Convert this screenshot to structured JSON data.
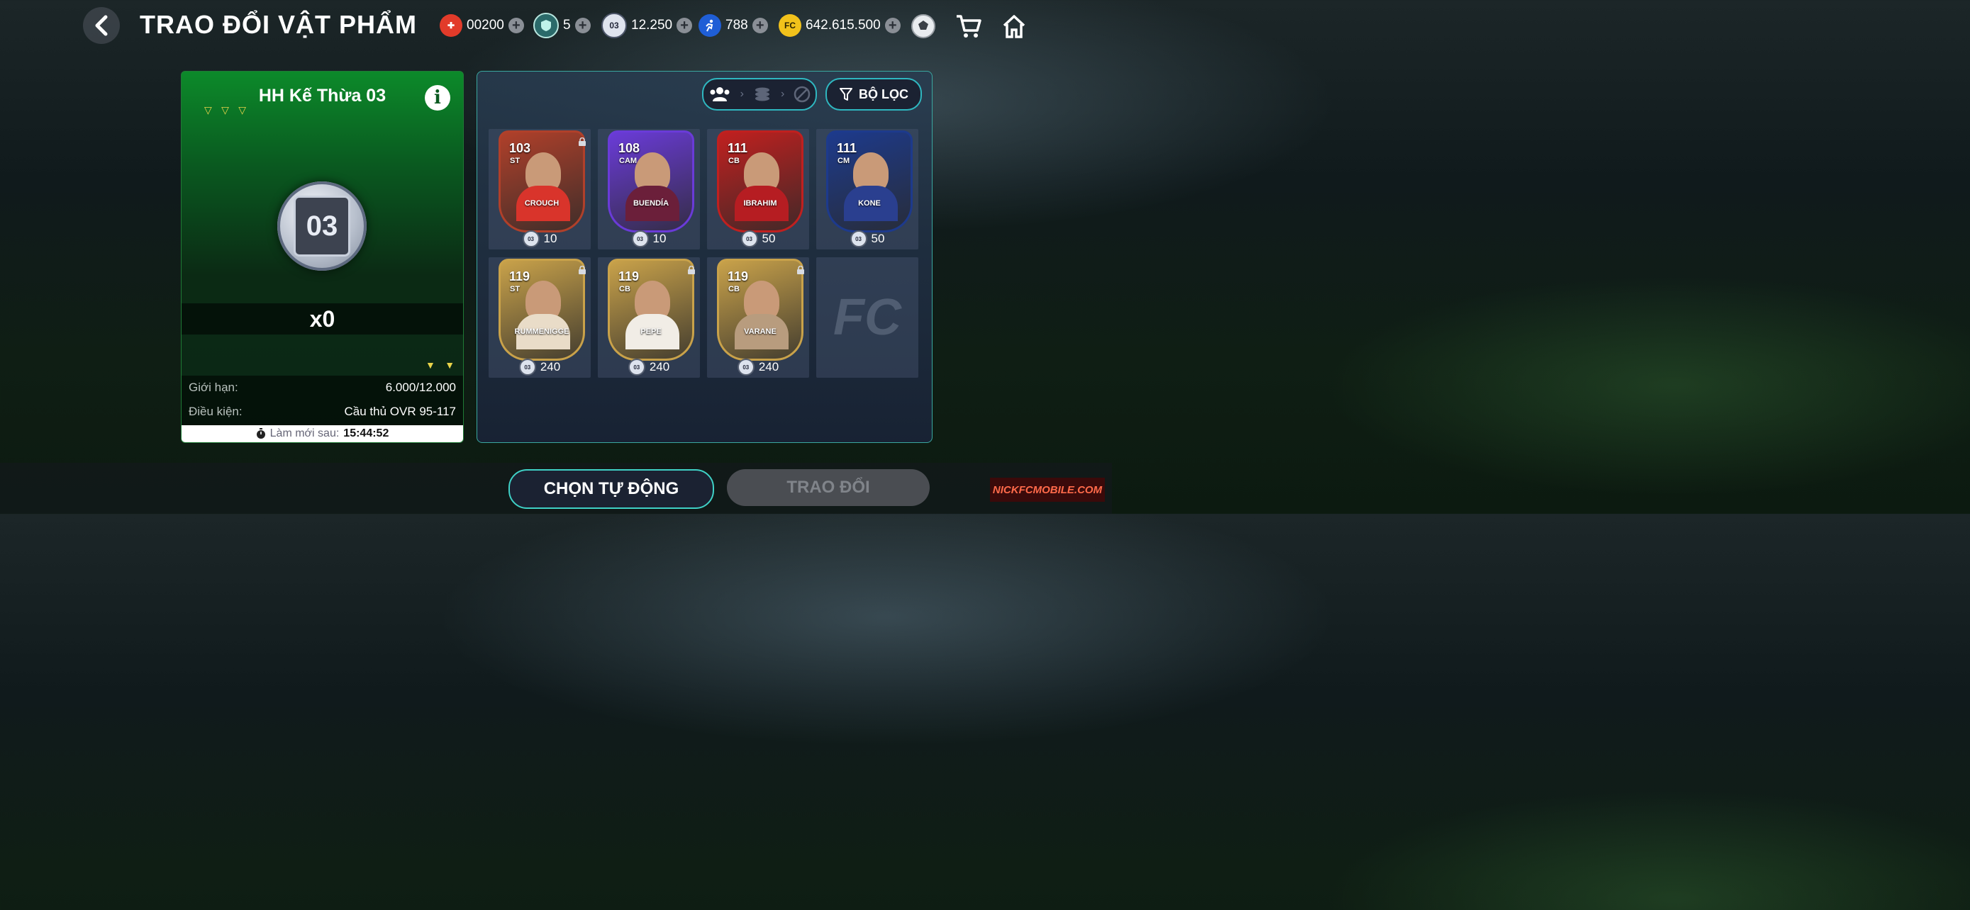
{
  "header": {
    "title": "TRAO ĐỔI VẬT PHẨM",
    "currencies": [
      {
        "icon": "puzzle-icon",
        "value": "00200"
      },
      {
        "icon": "gem-icon",
        "value": "5"
      },
      {
        "icon": "token-03-icon",
        "value": "12.250"
      },
      {
        "icon": "runner-icon",
        "value": "788"
      },
      {
        "icon": "fc-coin-icon",
        "value": "642.615.500"
      }
    ]
  },
  "left_panel": {
    "title": "HH Kế Thừa 03",
    "token_label": "03",
    "quantity": "x0",
    "limit_label": "Giới hạn:",
    "limit_value": "6.000/12.000",
    "condition_label": "Điều kiện:",
    "condition_value": "Cầu thủ OVR 95-117",
    "refresh_label": "Làm mới sau:",
    "refresh_time": "15:44:52"
  },
  "right_panel": {
    "filter_label": "BỘ LỌC",
    "players": [
      {
        "name": "CROUCH",
        "ovr": "103",
        "pos": "ST",
        "price": "10",
        "locked": true,
        "theme": "#b0402a",
        "kit": "#d9342b"
      },
      {
        "name": "BUENDÍA",
        "ovr": "108",
        "pos": "CAM",
        "price": "10",
        "locked": false,
        "theme": "#6a3bd8",
        "kit": "#6b1f3a"
      },
      {
        "name": "IBRAHIM",
        "ovr": "111",
        "pos": "CB",
        "price": "50",
        "locked": false,
        "theme": "#c0201f",
        "kit": "#b61d22"
      },
      {
        "name": "KONE",
        "ovr": "111",
        "pos": "CM",
        "price": "50",
        "locked": false,
        "theme": "#1d3a8c",
        "kit": "#2a3f8f"
      },
      {
        "name": "RUMMENIGGE",
        "ovr": "119",
        "pos": "ST",
        "price": "240",
        "locked": true,
        "theme": "#c9a24a",
        "kit": "#e9dcc8"
      },
      {
        "name": "PEPE",
        "ovr": "119",
        "pos": "CB",
        "price": "240",
        "locked": true,
        "theme": "#c9a24a",
        "kit": "#f1ede6"
      },
      {
        "name": "VARANE",
        "ovr": "119",
        "pos": "CB",
        "price": "240",
        "locked": true,
        "theme": "#c9a24a",
        "kit": "#b89c7e"
      }
    ],
    "empty_slot_logo": "FC"
  },
  "footer": {
    "auto_button": "CHỌN TỰ ĐỘNG",
    "trade_button": "TRAO ĐỔI",
    "watermark": "NICKFCMOBILE.COM"
  }
}
